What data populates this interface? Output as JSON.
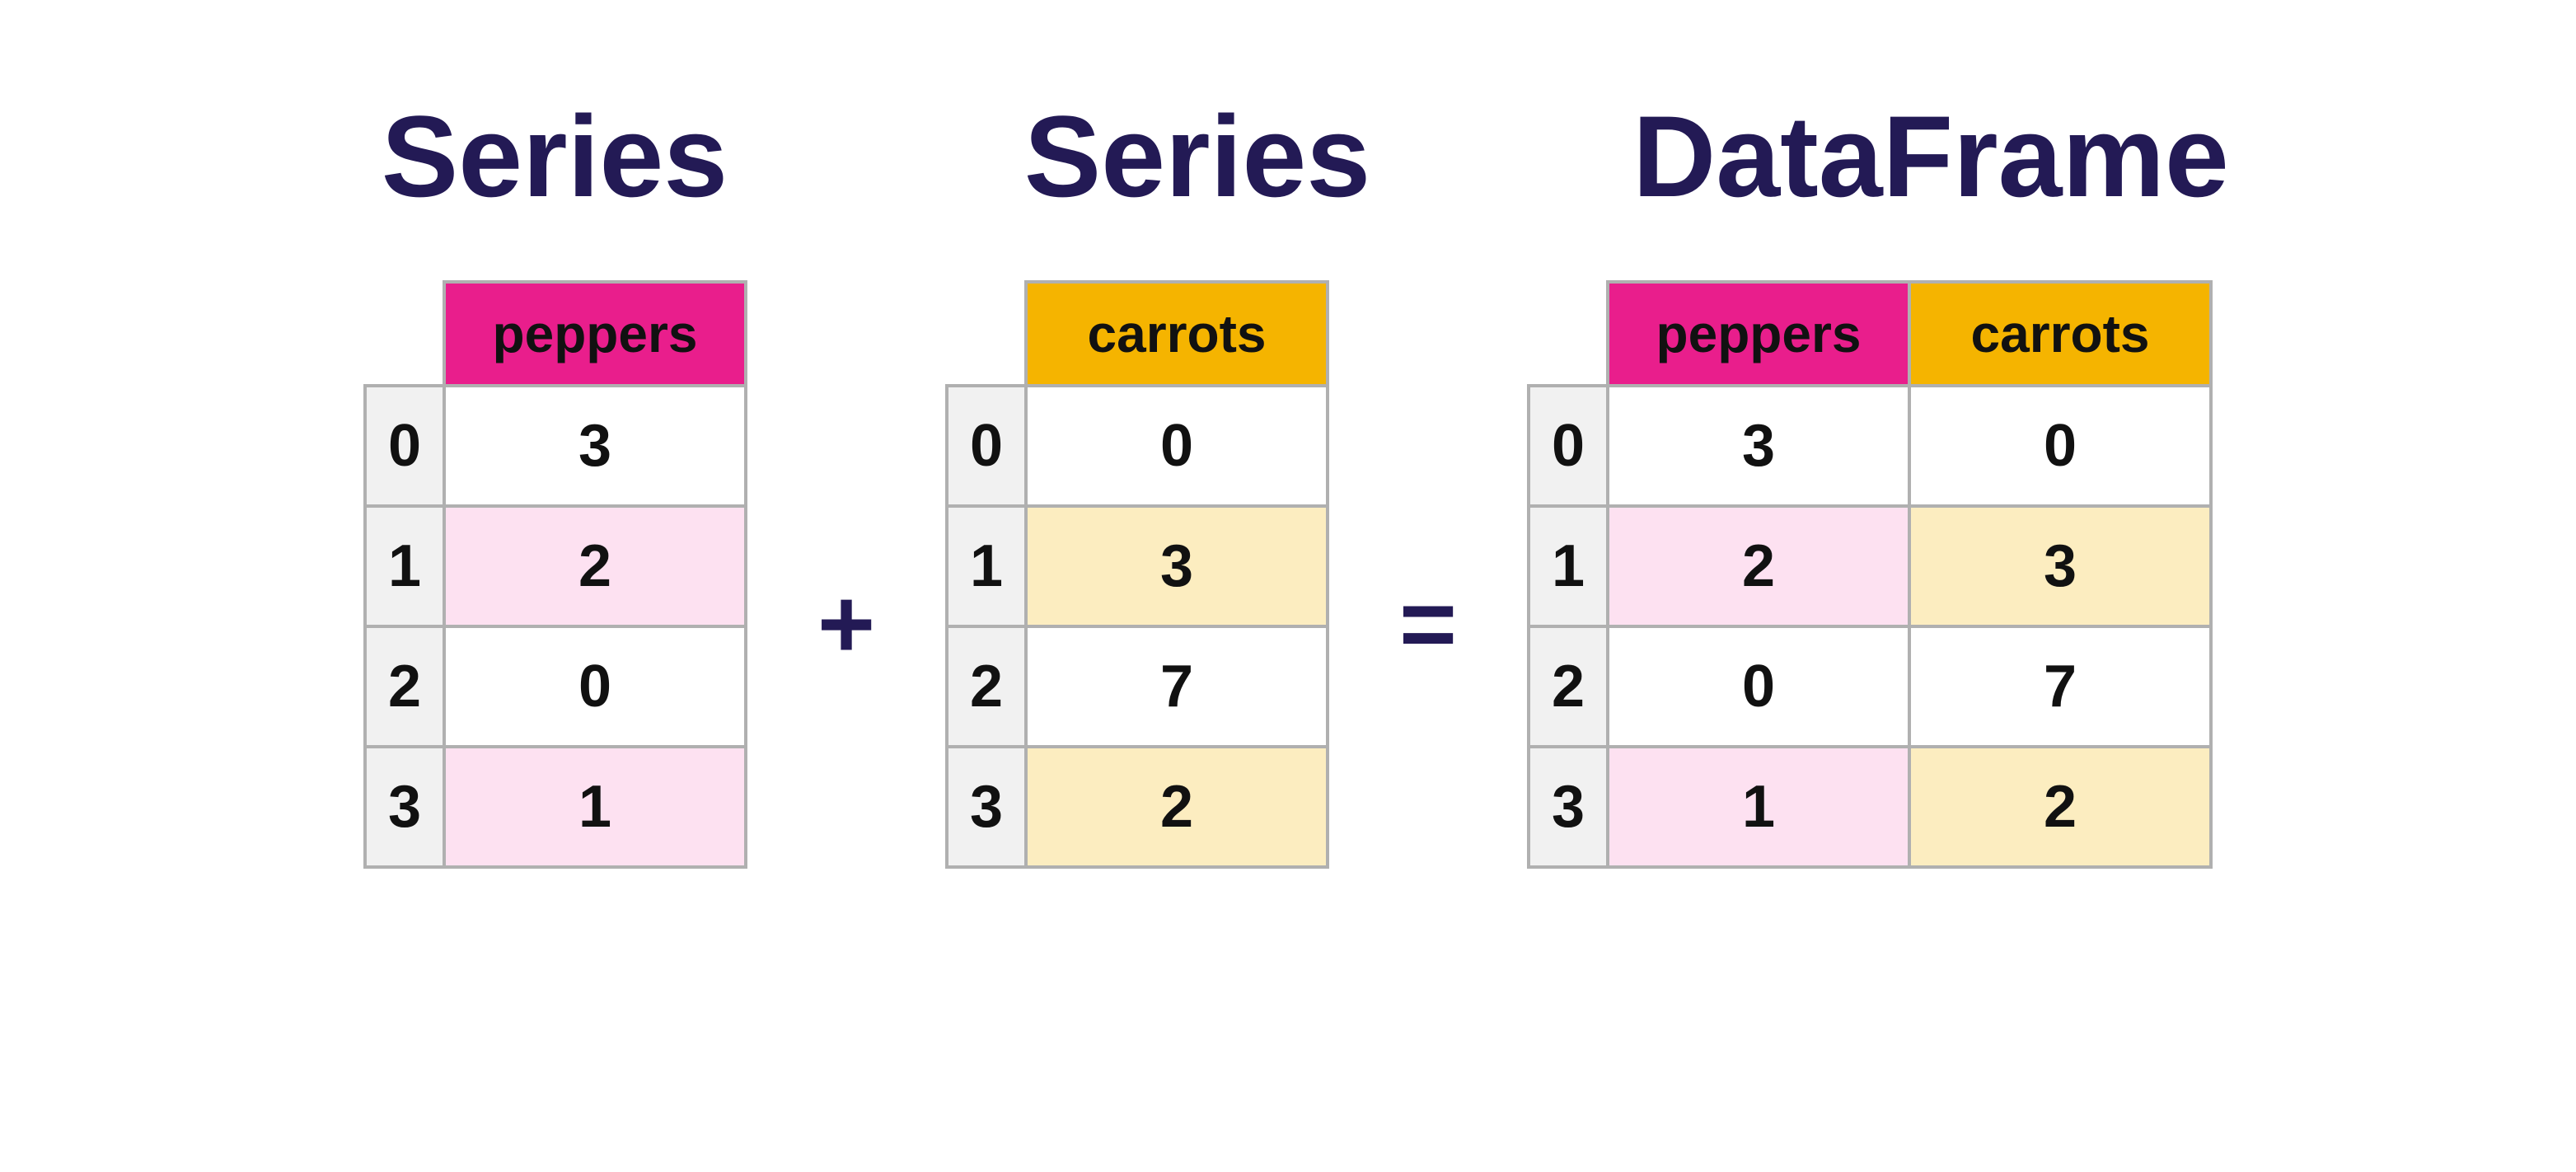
{
  "titles": {
    "series1": "Series",
    "series2": "Series",
    "dataframe": "DataFrame"
  },
  "operators": {
    "plus": "+",
    "equals": "="
  },
  "colors": {
    "title": "#231a55",
    "pink_header": "#e91e8c",
    "amber_header": "#f5b400",
    "pink_alt": "#fde1f1",
    "amber_alt": "#fcedc0",
    "grid": "#b0b0b0",
    "index_bg": "#f1f1f1"
  },
  "series1": {
    "header": "peppers",
    "index": [
      "0",
      "1",
      "2",
      "3"
    ],
    "values": [
      "3",
      "2",
      "0",
      "1"
    ]
  },
  "series2": {
    "header": "carrots",
    "index": [
      "0",
      "1",
      "2",
      "3"
    ],
    "values": [
      "0",
      "3",
      "7",
      "2"
    ]
  },
  "dataframe": {
    "headers": {
      "c0": "peppers",
      "c1": "carrots"
    },
    "index": [
      "0",
      "1",
      "2",
      "3"
    ],
    "col0": [
      "3",
      "2",
      "0",
      "1"
    ],
    "col1": [
      "0",
      "3",
      "7",
      "2"
    ]
  },
  "chart_data": {
    "type": "table",
    "title": "Series + Series = DataFrame",
    "tables": [
      {
        "name": "Series peppers",
        "index": [
          0,
          1,
          2,
          3
        ],
        "peppers": [
          3,
          2,
          0,
          1
        ]
      },
      {
        "name": "Series carrots",
        "index": [
          0,
          1,
          2,
          3
        ],
        "carrots": [
          0,
          3,
          7,
          2
        ]
      },
      {
        "name": "DataFrame",
        "index": [
          0,
          1,
          2,
          3
        ],
        "peppers": [
          3,
          2,
          0,
          1
        ],
        "carrots": [
          0,
          3,
          7,
          2
        ]
      }
    ],
    "relation": "concat_columns"
  }
}
